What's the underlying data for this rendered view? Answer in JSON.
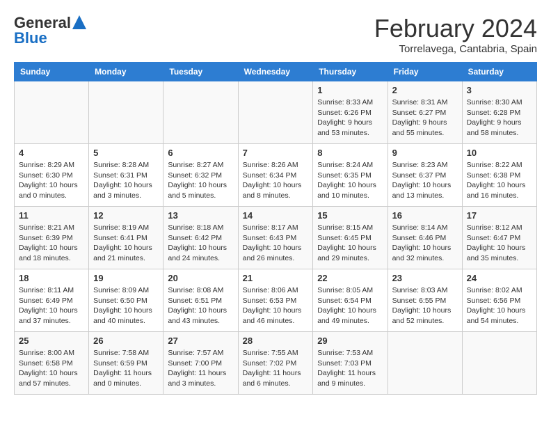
{
  "logo": {
    "general": "General",
    "blue": "Blue"
  },
  "title": "February 2024",
  "subtitle": "Torrelavega, Cantabria, Spain",
  "weekdays": [
    "Sunday",
    "Monday",
    "Tuesday",
    "Wednesday",
    "Thursday",
    "Friday",
    "Saturday"
  ],
  "weeks": [
    [
      {
        "day": "",
        "info": ""
      },
      {
        "day": "",
        "info": ""
      },
      {
        "day": "",
        "info": ""
      },
      {
        "day": "",
        "info": ""
      },
      {
        "day": "1",
        "info": "Sunrise: 8:33 AM\nSunset: 6:26 PM\nDaylight: 9 hours and 53 minutes."
      },
      {
        "day": "2",
        "info": "Sunrise: 8:31 AM\nSunset: 6:27 PM\nDaylight: 9 hours and 55 minutes."
      },
      {
        "day": "3",
        "info": "Sunrise: 8:30 AM\nSunset: 6:28 PM\nDaylight: 9 hours and 58 minutes."
      }
    ],
    [
      {
        "day": "4",
        "info": "Sunrise: 8:29 AM\nSunset: 6:30 PM\nDaylight: 10 hours and 0 minutes."
      },
      {
        "day": "5",
        "info": "Sunrise: 8:28 AM\nSunset: 6:31 PM\nDaylight: 10 hours and 3 minutes."
      },
      {
        "day": "6",
        "info": "Sunrise: 8:27 AM\nSunset: 6:32 PM\nDaylight: 10 hours and 5 minutes."
      },
      {
        "day": "7",
        "info": "Sunrise: 8:26 AM\nSunset: 6:34 PM\nDaylight: 10 hours and 8 minutes."
      },
      {
        "day": "8",
        "info": "Sunrise: 8:24 AM\nSunset: 6:35 PM\nDaylight: 10 hours and 10 minutes."
      },
      {
        "day": "9",
        "info": "Sunrise: 8:23 AM\nSunset: 6:37 PM\nDaylight: 10 hours and 13 minutes."
      },
      {
        "day": "10",
        "info": "Sunrise: 8:22 AM\nSunset: 6:38 PM\nDaylight: 10 hours and 16 minutes."
      }
    ],
    [
      {
        "day": "11",
        "info": "Sunrise: 8:21 AM\nSunset: 6:39 PM\nDaylight: 10 hours and 18 minutes."
      },
      {
        "day": "12",
        "info": "Sunrise: 8:19 AM\nSunset: 6:41 PM\nDaylight: 10 hours and 21 minutes."
      },
      {
        "day": "13",
        "info": "Sunrise: 8:18 AM\nSunset: 6:42 PM\nDaylight: 10 hours and 24 minutes."
      },
      {
        "day": "14",
        "info": "Sunrise: 8:17 AM\nSunset: 6:43 PM\nDaylight: 10 hours and 26 minutes."
      },
      {
        "day": "15",
        "info": "Sunrise: 8:15 AM\nSunset: 6:45 PM\nDaylight: 10 hours and 29 minutes."
      },
      {
        "day": "16",
        "info": "Sunrise: 8:14 AM\nSunset: 6:46 PM\nDaylight: 10 hours and 32 minutes."
      },
      {
        "day": "17",
        "info": "Sunrise: 8:12 AM\nSunset: 6:47 PM\nDaylight: 10 hours and 35 minutes."
      }
    ],
    [
      {
        "day": "18",
        "info": "Sunrise: 8:11 AM\nSunset: 6:49 PM\nDaylight: 10 hours and 37 minutes."
      },
      {
        "day": "19",
        "info": "Sunrise: 8:09 AM\nSunset: 6:50 PM\nDaylight: 10 hours and 40 minutes."
      },
      {
        "day": "20",
        "info": "Sunrise: 8:08 AM\nSunset: 6:51 PM\nDaylight: 10 hours and 43 minutes."
      },
      {
        "day": "21",
        "info": "Sunrise: 8:06 AM\nSunset: 6:53 PM\nDaylight: 10 hours and 46 minutes."
      },
      {
        "day": "22",
        "info": "Sunrise: 8:05 AM\nSunset: 6:54 PM\nDaylight: 10 hours and 49 minutes."
      },
      {
        "day": "23",
        "info": "Sunrise: 8:03 AM\nSunset: 6:55 PM\nDaylight: 10 hours and 52 minutes."
      },
      {
        "day": "24",
        "info": "Sunrise: 8:02 AM\nSunset: 6:56 PM\nDaylight: 10 hours and 54 minutes."
      }
    ],
    [
      {
        "day": "25",
        "info": "Sunrise: 8:00 AM\nSunset: 6:58 PM\nDaylight: 10 hours and 57 minutes."
      },
      {
        "day": "26",
        "info": "Sunrise: 7:58 AM\nSunset: 6:59 PM\nDaylight: 11 hours and 0 minutes."
      },
      {
        "day": "27",
        "info": "Sunrise: 7:57 AM\nSunset: 7:00 PM\nDaylight: 11 hours and 3 minutes."
      },
      {
        "day": "28",
        "info": "Sunrise: 7:55 AM\nSunset: 7:02 PM\nDaylight: 11 hours and 6 minutes."
      },
      {
        "day": "29",
        "info": "Sunrise: 7:53 AM\nSunset: 7:03 PM\nDaylight: 11 hours and 9 minutes."
      },
      {
        "day": "",
        "info": ""
      },
      {
        "day": "",
        "info": ""
      }
    ]
  ]
}
